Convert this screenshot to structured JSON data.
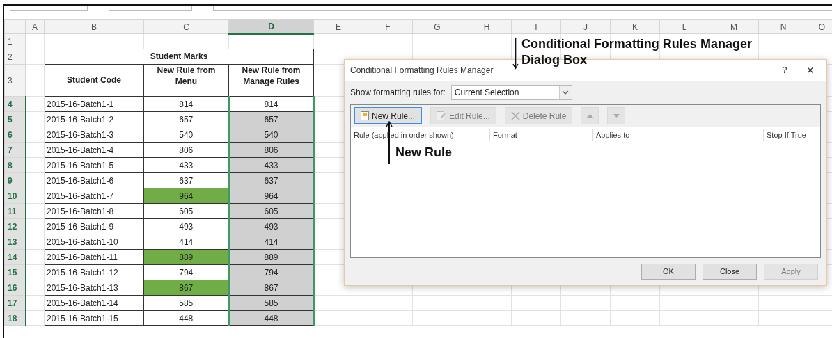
{
  "spreadsheet": {
    "columns": [
      {
        "label": "A",
        "selected": false
      },
      {
        "label": "B",
        "selected": false
      },
      {
        "label": "C",
        "selected": false
      },
      {
        "label": "D",
        "selected": true
      },
      {
        "label": "E",
        "selected": false
      },
      {
        "label": "F",
        "selected": false
      },
      {
        "label": "G",
        "selected": false
      },
      {
        "label": "H",
        "selected": false
      },
      {
        "label": "I",
        "selected": false
      },
      {
        "label": "J",
        "selected": false
      },
      {
        "label": "K",
        "selected": false
      },
      {
        "label": "L",
        "selected": false
      },
      {
        "label": "M",
        "selected": false
      },
      {
        "label": "N",
        "selected": false
      },
      {
        "label": "O",
        "selected": false
      }
    ],
    "rows": [
      {
        "label": "1",
        "selected": false
      },
      {
        "label": "2",
        "selected": false
      },
      {
        "label": "3",
        "selected": false
      },
      {
        "label": "4",
        "selected": true
      },
      {
        "label": "5",
        "selected": true
      },
      {
        "label": "6",
        "selected": true
      },
      {
        "label": "7",
        "selected": true
      },
      {
        "label": "8",
        "selected": true
      },
      {
        "label": "9",
        "selected": true
      },
      {
        "label": "10",
        "selected": true
      },
      {
        "label": "11",
        "selected": true
      },
      {
        "label": "12",
        "selected": true
      },
      {
        "label": "13",
        "selected": true
      },
      {
        "label": "14",
        "selected": true
      },
      {
        "label": "15",
        "selected": true
      },
      {
        "label": "16",
        "selected": true
      },
      {
        "label": "17",
        "selected": true
      },
      {
        "label": "18",
        "selected": true
      }
    ]
  },
  "table": {
    "title": "Student Marks",
    "columns": [
      "Student Code",
      "New Rule from Menu",
      "New Rule from Manage Rules"
    ],
    "rows": [
      {
        "code": "2015-16-Batch1-1",
        "menu": {
          "value": "814",
          "highlighted": false
        },
        "manage": {
          "value": "814",
          "highlighted": false
        }
      },
      {
        "code": "2015-16-Batch1-2",
        "menu": {
          "value": "657",
          "highlighted": false
        },
        "manage": {
          "value": "657",
          "highlighted": true
        }
      },
      {
        "code": "2015-16-Batch1-3",
        "menu": {
          "value": "540",
          "highlighted": false
        },
        "manage": {
          "value": "540",
          "highlighted": true
        }
      },
      {
        "code": "2015-16-Batch1-4",
        "menu": {
          "value": "806",
          "highlighted": false
        },
        "manage": {
          "value": "806",
          "highlighted": true
        }
      },
      {
        "code": "2015-16-Batch1-5",
        "menu": {
          "value": "433",
          "highlighted": false
        },
        "manage": {
          "value": "433",
          "highlighted": true
        }
      },
      {
        "code": "2015-16-Batch1-6",
        "menu": {
          "value": "637",
          "highlighted": false
        },
        "manage": {
          "value": "637",
          "highlighted": true
        }
      },
      {
        "code": "2015-16-Batch1-7",
        "menu": {
          "value": "964",
          "highlighted": true
        },
        "manage": {
          "value": "964",
          "highlighted": true
        }
      },
      {
        "code": "2015-16-Batch1-8",
        "menu": {
          "value": "605",
          "highlighted": false
        },
        "manage": {
          "value": "605",
          "highlighted": true
        }
      },
      {
        "code": "2015-16-Batch1-9",
        "menu": {
          "value": "493",
          "highlighted": false
        },
        "manage": {
          "value": "493",
          "highlighted": true
        }
      },
      {
        "code": "2015-16-Batch1-10",
        "menu": {
          "value": "414",
          "highlighted": false
        },
        "manage": {
          "value": "414",
          "highlighted": true
        }
      },
      {
        "code": "2015-16-Batch1-11",
        "menu": {
          "value": "889",
          "highlighted": true
        },
        "manage": {
          "value": "889",
          "highlighted": true
        }
      },
      {
        "code": "2015-16-Batch1-12",
        "menu": {
          "value": "794",
          "highlighted": false
        },
        "manage": {
          "value": "794",
          "highlighted": true
        }
      },
      {
        "code": "2015-16-Batch1-13",
        "menu": {
          "value": "867",
          "highlighted": true
        },
        "manage": {
          "value": "867",
          "highlighted": true
        }
      },
      {
        "code": "2015-16-Batch1-14",
        "menu": {
          "value": "585",
          "highlighted": false
        },
        "manage": {
          "value": "585",
          "highlighted": true
        }
      },
      {
        "code": "2015-16-Batch1-15",
        "menu": {
          "value": "448",
          "highlighted": false
        },
        "manage": {
          "value": "448",
          "highlighted": true
        }
      }
    ]
  },
  "dialog": {
    "title": "Conditional Formatting Rules Manager",
    "help": "?",
    "close": "×",
    "show_label": "Show formatting rules for:",
    "show_value": "Current Selection",
    "toolbar": [
      {
        "kind": "new",
        "label": "New Rule...",
        "disabled": false
      },
      {
        "kind": "edit",
        "label": "Edit Rule...",
        "disabled": true
      },
      {
        "kind": "delete",
        "label": "Delete Rule",
        "disabled": true
      },
      {
        "kind": "up",
        "disabled": true
      },
      {
        "kind": "down",
        "disabled": true
      }
    ],
    "columns": [
      "Rule (applied in order shown)",
      "Format",
      "Applies to",
      "Stop If True"
    ],
    "buttons": [
      {
        "label": "OK",
        "disabled": false
      },
      {
        "label": "Close",
        "disabled": false
      },
      {
        "label": "Apply",
        "disabled": true
      }
    ]
  },
  "annotations": [
    {
      "kind": "down",
      "text": "Conditional Formatting Rules Manager Dialog Box"
    },
    {
      "kind": "up",
      "text": "New Rule"
    }
  ]
}
